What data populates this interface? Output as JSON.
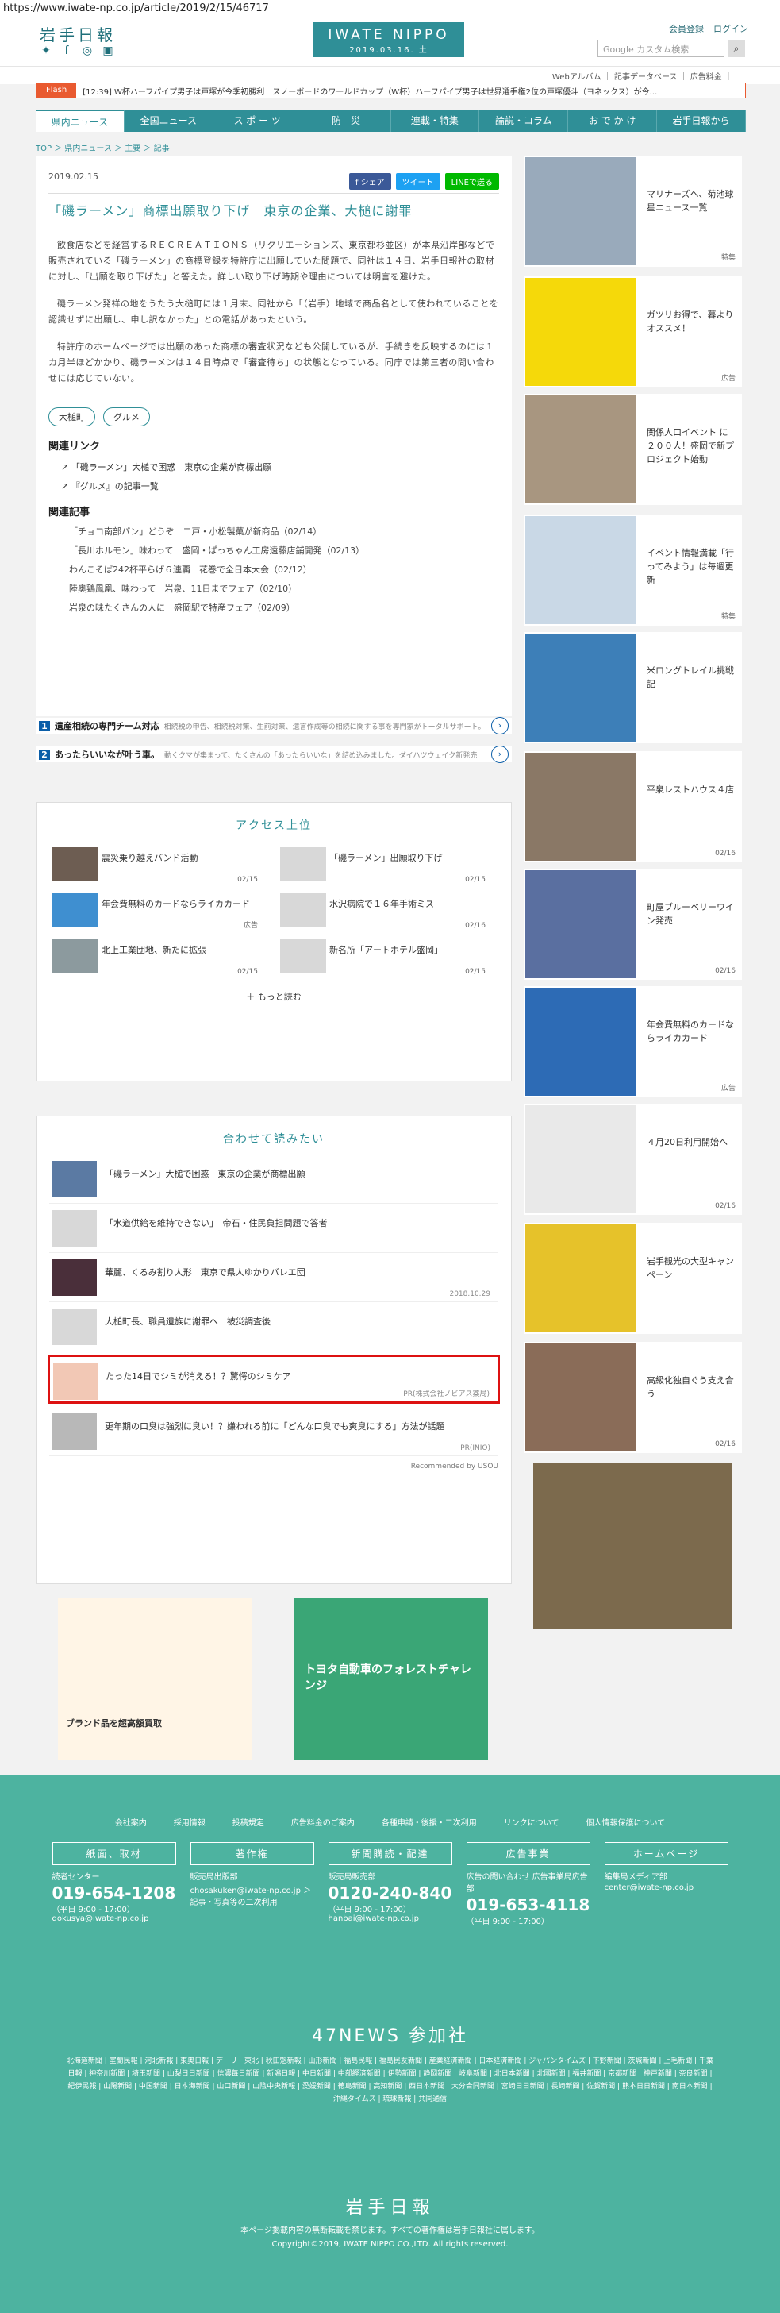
{
  "url": "https://www.iwate-np.co.jp/article/2019/2/15/46717",
  "header": {
    "logo_ja": "岩手日報",
    "brand": "IWATE NIPPO",
    "date": "2019.03.16. 土",
    "links": [
      "会員登録",
      "ログイン"
    ],
    "search_placeholder": "Google カスタム検索",
    "subnav": "Webアルバム ｜ 記事データベース ｜ 広告料金 ｜"
  },
  "flash": {
    "label": "Flash",
    "text": "[12:39] W杯ハーフパイプ男子は戸塚が今季初勝利　スノーボードのワールドカップ（W杯）ハーフパイプ男子は世界選手権2位の戸塚優斗（ヨネックス）が今..."
  },
  "nav": [
    "県内ニュース",
    "全国ニュース",
    "ス ポ ー ツ",
    "防　災",
    "連載・特集",
    "論説・コラム",
    "お で か け",
    "岩手日報から"
  ],
  "breadcrumb": "TOP ＞ 県内ニュース ＞ 主要 ＞ 記事",
  "article": {
    "date": "2019.02.15",
    "share": "f シェア",
    "tweet": "ツイート",
    "line": "LINEで送る",
    "title": "「磯ラーメン」商標出願取り下げ　東京の企業、大槌に謝罪",
    "paragraphs": [
      "飲食店などを経営するＲＥＣＲＥＡＴＩＯＮＳ（リクリエーションズ、東京都杉並区）が本県沿岸部などで販売されている「磯ラーメン」の商標登録を特許庁に出願していた問題で、同社は１４日、岩手日報社の取材に対し、「出願を取り下げた」と答えた。詳しい取り下げ時期や理由については明言を避けた。",
      "磯ラーメン発祥の地をうたう大槌町には１月末、同社から「（岩手）地域で商品名として使われていることを認識せずに出願し、申し訳なかった」との電話があったという。",
      "特許庁のホームページでは出願のあった商標の審査状況なども公開しているが、手続きを反映するのには１カ月半ほどかかり、磯ラーメンは１４日時点で「審査待ち」の状態となっている。同庁では第三者の問い合わせには応じていない。"
    ],
    "tags": [
      "大槌町",
      "グルメ"
    ],
    "related_links_heading": "関連リンク",
    "related_links": [
      "「磯ラーメン」大槌で困惑　東京の企業が商標出願",
      "『グルメ』の記事一覧"
    ],
    "related_articles_heading": "関連記事",
    "related_articles": [
      "「チョコ南部パン」どうぞ　二戸・小松製菓が新商品（02/14）",
      "「長川ホルモン」味わって　盛岡・ぱっちゃん工房遠藤店舗開発（02/13）",
      "わんこそば242杯平らげ６連覇　花巻で全日本大会（02/12）",
      "陸奥鶏鳳凰、味わって　岩泉、11日までフェア（02/10）",
      "岩泉の味たくさんの人に　盛岡駅で特産フェア（02/09）"
    ]
  },
  "ads": [
    {
      "n": "1",
      "title": "遺産相続の専門チーム対応",
      "sub": "相続税の申告、相続税対策、生前対策、遺言作成等の相続に関する事を専門家がトータルサポート。ベリーベスト税理士事務所"
    },
    {
      "n": "2",
      "title": "あったらいいなが叶う車。",
      "sub": "動くクマが集まって、たくさんの「あったらいいな」を詰め込みました。ダイハツウェイク新発売"
    }
  ],
  "access": {
    "heading": "アクセス上位",
    "items": [
      {
        "title": "震災乗り越えバンド活動",
        "date": "02/15"
      },
      {
        "title": "「磯ラーメン」出願取り下げ",
        "date": "02/15"
      },
      {
        "title": "年会費無料のカードならライカカード",
        "date": "広告"
      },
      {
        "title": "水沢病院で１６年手術ミス",
        "date": "02/16"
      },
      {
        "title": "北上工業団地、新たに拡張",
        "date": "02/15"
      },
      {
        "title": "新名所「アートホテル盛岡」",
        "date": "02/15"
      }
    ],
    "more": "もっと読む"
  },
  "read": {
    "heading": "合わせて読みたい",
    "items": [
      {
        "title": "「磯ラーメン」大槌で困惑　東京の企業が商標出願",
        "date": ""
      },
      {
        "title": "「水道供給を維持できない」　帝石・住民負担問題で答者",
        "date": ""
      },
      {
        "title": "華麗、くるみ割り人形　東京で県人ゆかりバレエ団",
        "date": "2018.10.29"
      },
      {
        "title": "大槌町長、職員遺族に謝罪へ　被災調査後",
        "date": ""
      },
      {
        "title": "たった14日でシミが消える！？驚愕のシミケア",
        "date": "PR(株式会社ノビアス薬局)"
      },
      {
        "title": "更年期の口臭は強烈に臭い！？嫌われる前に「どんな口臭でも爽臭にする」方法が話題",
        "date": "PR(INIO)"
      }
    ],
    "recommended": "Recommended by USOU"
  },
  "bottom_ads": [
    "ブランド品を超高額買取",
    "トヨタ自動車のフォレストチャレンジ"
  ],
  "sidebar": [
    {
      "text": "マリナーズへ、菊池球星ニュース一覧",
      "bottom": "特集"
    },
    {
      "text": "ガツリお得で、暮よりオススメ！",
      "bottom": "広告"
    },
    {
      "text": "関係人口イベント に２００人！盛岡で新プロジェクト始動",
      "bottom": ""
    },
    {
      "text": "イベント情報満載「行ってみよう」は毎週更新",
      "bottom": "特集"
    },
    {
      "text": "米ロングトレイル挑戦記",
      "bottom": ""
    },
    {
      "text": "平泉レストハウス４店",
      "bottom": "02/16"
    },
    {
      "text": "町屋ブルーベリーワイン発売",
      "bottom": "02/16"
    },
    {
      "text": "年会費無料のカードならライカカード",
      "bottom": "広告"
    },
    {
      "text": "４月20日利用開始へ",
      "bottom": "02/16"
    },
    {
      "text": "岩手観光の大型キャンペーン",
      "bottom": ""
    },
    {
      "text": "高級化独自ぐう支え合う",
      "bottom": "02/16"
    }
  ],
  "footer": {
    "links": [
      "会社案内",
      "採用情報",
      "投稿規定",
      "広告料金のご案内",
      "各種申請・後援・二次利用",
      "リンクについて",
      "個人情報保護について"
    ],
    "cols": [
      {
        "h": "紙面、取材",
        "l": "読者センター",
        "big": "019-654-1208",
        "s": "（平日 9:00 - 17:00） dokusya@iwate-np.co.jp"
      },
      {
        "h": "著作権",
        "l": "販売局出版部",
        "big": "",
        "s": "chosakuken@iwate-np.co.jp ＞記事・写真等の二次利用"
      },
      {
        "h": "新聞購読・配達",
        "l": "販売局販売部",
        "big": "0120-240-840",
        "s": "（平日 9:00 - 17:00） hanbai@iwate-np.co.jp"
      },
      {
        "h": "広告事業",
        "l": "広告の問い合わせ 広告事業局広告部",
        "big": "019-653-4118",
        "s": "（平日 9:00 - 17:00）"
      },
      {
        "h": "ホームページ",
        "l": "編集局メディア部",
        "big": "",
        "s": "center@iwate-np.co.jp"
      }
    ],
    "news47": "47NEWS 参加社",
    "papers": "北海道新聞 | 室蘭民報 | 河北新報 | 東奥日報 | デーリー東北 | 秋田魁新報 | 山形新聞 | 福島民報 | 福島民友新聞 | 産業経済新聞 | 日本経済新聞 | ジャパンタイムズ | 下野新聞 | 茨城新聞 | 上毛新聞 | 千葉日報 | 神奈川新聞 | 埼玉新聞 | 山梨日日新聞 | 信濃毎日新聞 | 新潟日報 | 中日新聞 | 中部経済新聞 | 伊勢新聞 | 静岡新聞 | 岐阜新聞 | 北日本新聞 | 北國新聞 | 福井新聞 | 京都新聞 | 神戸新聞 | 奈良新聞 | 紀伊民報 | 山陽新聞 | 中国新聞 | 日本海新聞 | 山口新聞 | 山陰中央新報 | 愛媛新聞 | 徳島新聞 | 高知新聞 | 西日本新聞 | 大分合同新聞 | 宮崎日日新聞 | 長崎新聞 | 佐賀新聞 | 熊本日日新聞 | 南日本新聞 | 沖縄タイムス | 琉球新報 | 共同通信",
    "logo": "岩手日報",
    "note": "本ページ掲載内容の無断転載を禁じます。すべての著作権は岩手日報社に属します。",
    "copy": "Copyright©2019, IWATE NIPPO CO.,LTD. All rights reserved."
  }
}
